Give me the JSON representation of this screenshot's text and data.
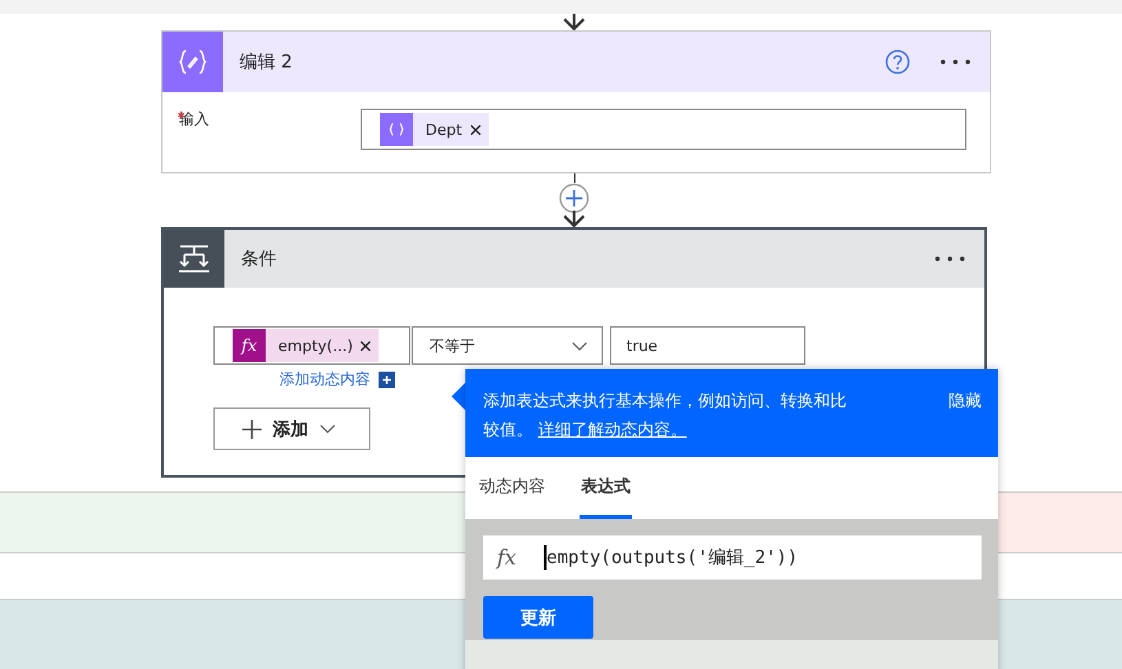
{
  "compose": {
    "title": "编辑 2",
    "help": true,
    "field": {
      "label": "输入",
      "required": true,
      "token": "Dept"
    }
  },
  "condition": {
    "title": "条件",
    "left_token_icon": "fx",
    "left_token": "empty(...)",
    "operator": "不等于",
    "right_value": "true",
    "add_dynamic_link": "添加动态内容",
    "add_button": "添加"
  },
  "popup": {
    "message": "添加表达式来执行基本操作，例如访问、转换和比较值。",
    "link": "详细了解动态内容。",
    "hide": "隐藏",
    "tabs": [
      {
        "label": "动态内容",
        "selected": false
      },
      {
        "label": "表达式",
        "selected": true
      }
    ],
    "expression_icon": "fx",
    "expression": "empty(outputs('编辑_2'))",
    "update_button": "更新"
  }
}
